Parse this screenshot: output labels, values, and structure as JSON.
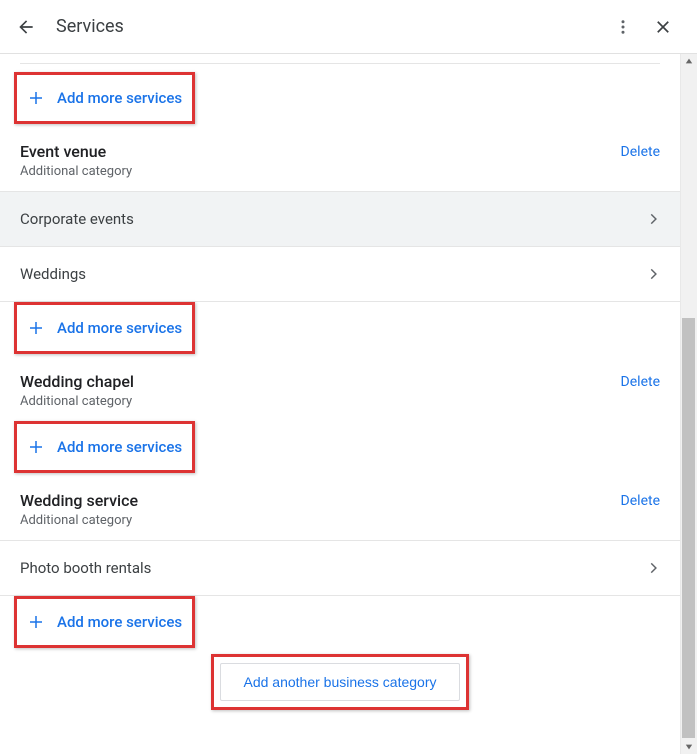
{
  "header": {
    "title": "Services"
  },
  "addMoreLabel": "Add more services",
  "addCategoryLabel": "Add another business category",
  "deleteLabel": "Delete",
  "subLabel": "Additional category",
  "categories": [
    {
      "name": "Event venue"
    },
    {
      "name": "Wedding chapel"
    },
    {
      "name": "Wedding service"
    }
  ],
  "servicesTop": [
    {
      "label": "Corporate events",
      "shaded": true
    },
    {
      "label": "Weddings",
      "shaded": false
    }
  ],
  "servicesBottom": [
    {
      "label": "Photo booth rentals"
    }
  ]
}
